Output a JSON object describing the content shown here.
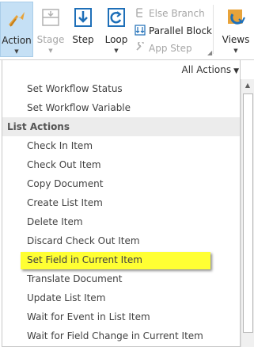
{
  "ribbon": {
    "action": "Action",
    "stage": "Stage",
    "step": "Step",
    "loop": "Loop",
    "else_branch": "Else Branch",
    "parallel_block": "Parallel Block",
    "app_step": "App Step",
    "views": "Views",
    "dropdown_arrow": "▼",
    "colors": {
      "active_bg": "#c5e0f5",
      "icon_blue": "#1e6fb8",
      "icon_orange": "#e8a33a"
    }
  },
  "dropdown": {
    "filter_label": "All Actions",
    "filter_arrow": "▼",
    "items_top": [
      "Set Workflow Status",
      "Set Workflow Variable"
    ],
    "group_label": "List Actions",
    "list_actions": [
      "Check In Item",
      "Check Out Item",
      "Copy Document",
      "Create List Item",
      "Delete Item",
      "Discard Check Out Item",
      "Set Field in Current Item",
      "Translate Document",
      "Update List Item",
      "Wait for Event in List Item",
      "Wait for Field Change in Current Item"
    ],
    "highlight_color": "#ffff33",
    "scroll_up": "▲"
  }
}
